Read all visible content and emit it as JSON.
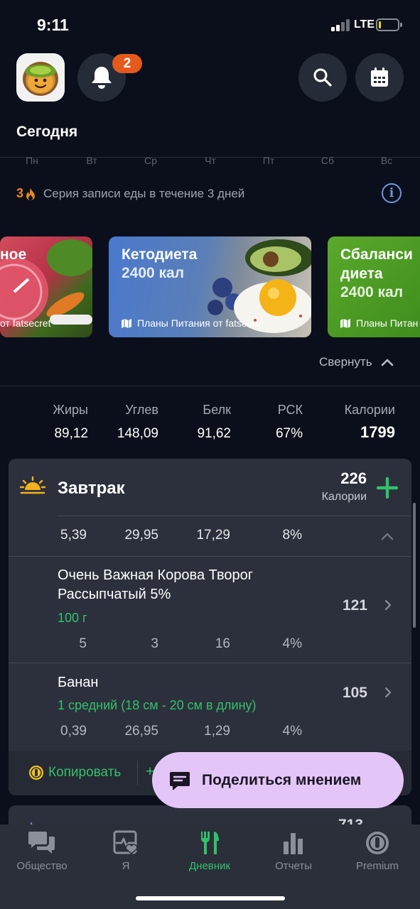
{
  "status_bar": {
    "time": "9:11",
    "network": "LTE"
  },
  "header": {
    "notifications_count": "2",
    "title": "Сегодня"
  },
  "week": {
    "days": [
      "Пн",
      "Вт",
      "Ср",
      "Чт",
      "Пт",
      "Сб",
      "Вс"
    ]
  },
  "streak": {
    "count": "3",
    "text": "Серия записи еды в течение 3 дней"
  },
  "plans": [
    {
      "title": "ное",
      "kcal": "",
      "source": "от fatsecret",
      "color": "#c4374c"
    },
    {
      "title": "Кетодиета",
      "kcal": "2400 кал",
      "source": "Планы Питания от fatsecret",
      "color": "#4d78c9"
    },
    {
      "title": "Сбаланси\nдиета",
      "kcal": "2400 кал",
      "source": "Планы Питан",
      "color": "#4d9a25"
    }
  ],
  "collapse_label": "Свернуть",
  "totals": {
    "fat_label": "Жиры",
    "fat": "89,12",
    "carbs_label": "Углев",
    "carbs": "148,09",
    "protein_label": "Белк",
    "protein": "91,62",
    "rdi_label": "РСК",
    "rdi": "67%",
    "calories_label": "Калории",
    "calories": "1799"
  },
  "breakfast": {
    "title": "Завтрак",
    "calories": "226",
    "calories_label": "Калории",
    "macros": {
      "fat": "5,39",
      "carbs": "29,95",
      "protein": "17,29",
      "rdi": "8%"
    },
    "items": [
      {
        "name": "Очень Важная Корова Творог Рассыпчатый 5%",
        "portion": "100 г",
        "calories": "121",
        "macros": {
          "fat": "5",
          "carbs": "3",
          "protein": "16",
          "rdi": "4%"
        }
      },
      {
        "name": "Банан",
        "portion": "1 средний (18 см - 20 см в длину)",
        "calories": "105",
        "macros": {
          "fat": "0,39",
          "carbs": "26,95",
          "protein": "1,29",
          "rdi": "4%"
        }
      }
    ],
    "copy_label": "Копировать"
  },
  "feedback_label": "Поделиться мнением",
  "next_meal_calories": "713",
  "tabs": [
    {
      "label": "Общество",
      "icon": "community-icon"
    },
    {
      "label": "Я",
      "icon": "heart-pulse-icon"
    },
    {
      "label": "Дневник",
      "icon": "fork-knife-icon",
      "active": true
    },
    {
      "label": "Отчеты",
      "icon": "bar-chart-icon"
    },
    {
      "label": "Premium",
      "icon": "premium-lock-icon"
    }
  ],
  "colors": {
    "accent_green": "#33c06b",
    "badge_orange": "#e55a1c",
    "streak_orange": "#e88a1a",
    "info_blue": "#6f95e6",
    "feedback_purple": "#e3c6f7"
  }
}
